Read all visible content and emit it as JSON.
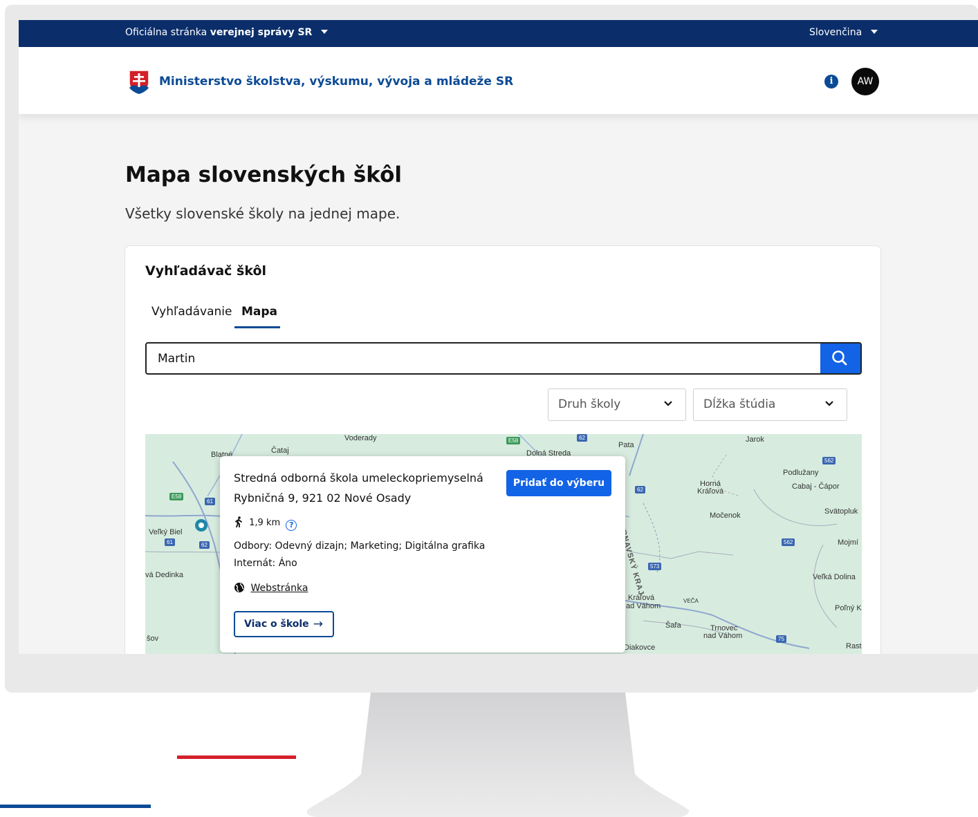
{
  "govbar": {
    "left_prefix": "Oficiálna stránka",
    "left_bold": "verejnej správy SR",
    "language": "Slovenčina"
  },
  "header": {
    "ministry": "Ministerstvo školstva, výskumu, vývoja a mládeže SR",
    "info_glyph": "i",
    "avatar_initials": "AW"
  },
  "page": {
    "title": "Mapa slovenských škôl",
    "subtitle": "Všetky slovenské školy na jednej mape."
  },
  "finder": {
    "title": "Vyhľadávač škôl",
    "tabs": [
      {
        "label": "Vyhľadávanie"
      },
      {
        "label": "Mapa",
        "active": true
      }
    ],
    "search_value": "Martin",
    "filters": [
      {
        "label": "Druh školy"
      },
      {
        "label": "Dĺžka štúdia"
      }
    ]
  },
  "map": {
    "labels": [
      {
        "text": "Voderady"
      },
      {
        "text": "Čataj"
      },
      {
        "text": "Blatné"
      },
      {
        "text": "Dolná Streda"
      },
      {
        "text": "Pata"
      },
      {
        "text": "Jarok"
      },
      {
        "text": "Podlužany"
      },
      {
        "text": "Cabaj - Čápor"
      },
      {
        "text": "Horná"
      },
      {
        "text": "Kráľová"
      },
      {
        "text": "Močenok"
      },
      {
        "text": "Svätopluk"
      },
      {
        "text": "Veľký Biel"
      },
      {
        "text": "Mojmí"
      },
      {
        "text": "vá Dedinka"
      },
      {
        "text": "Veľká Dolina"
      },
      {
        "text": "Kráľová"
      },
      {
        "text": "ad Váhom"
      },
      {
        "text": "Poľný K"
      },
      {
        "text": "Šaľa"
      },
      {
        "text": "Trnovec"
      },
      {
        "text": "nad Váhom"
      },
      {
        "text": "šov"
      },
      {
        "text": "Diakovce"
      },
      {
        "text": "Rast"
      },
      {
        "text": "TRNAVSKÝ KRAJ"
      },
      {
        "text": "VEČA"
      }
    ],
    "road_signs": [
      "E58",
      "61",
      "62",
      "E58",
      "62",
      "562",
      "61",
      "62",
      "562",
      "573",
      "75"
    ]
  },
  "popup": {
    "name": "Stredná odborná škola umeleckopriemyselná",
    "address": "Rybničná 9, 921 02 Nové Osady",
    "add_button": "Pridať do výberu",
    "distance": "1,9 km",
    "help_glyph": "?",
    "fields": "Odbory: Odevný dizajn; Marketing; Digitálna grafika",
    "internat": "Internát: Áno",
    "website": "Webstránka",
    "more_button": "Viac o škole",
    "more_arrow": "→"
  },
  "colors": {
    "navy": "#0b2e6b",
    "brand_blue": "#0b4a95",
    "action_blue": "#1263e6",
    "red": "#d4202a"
  }
}
